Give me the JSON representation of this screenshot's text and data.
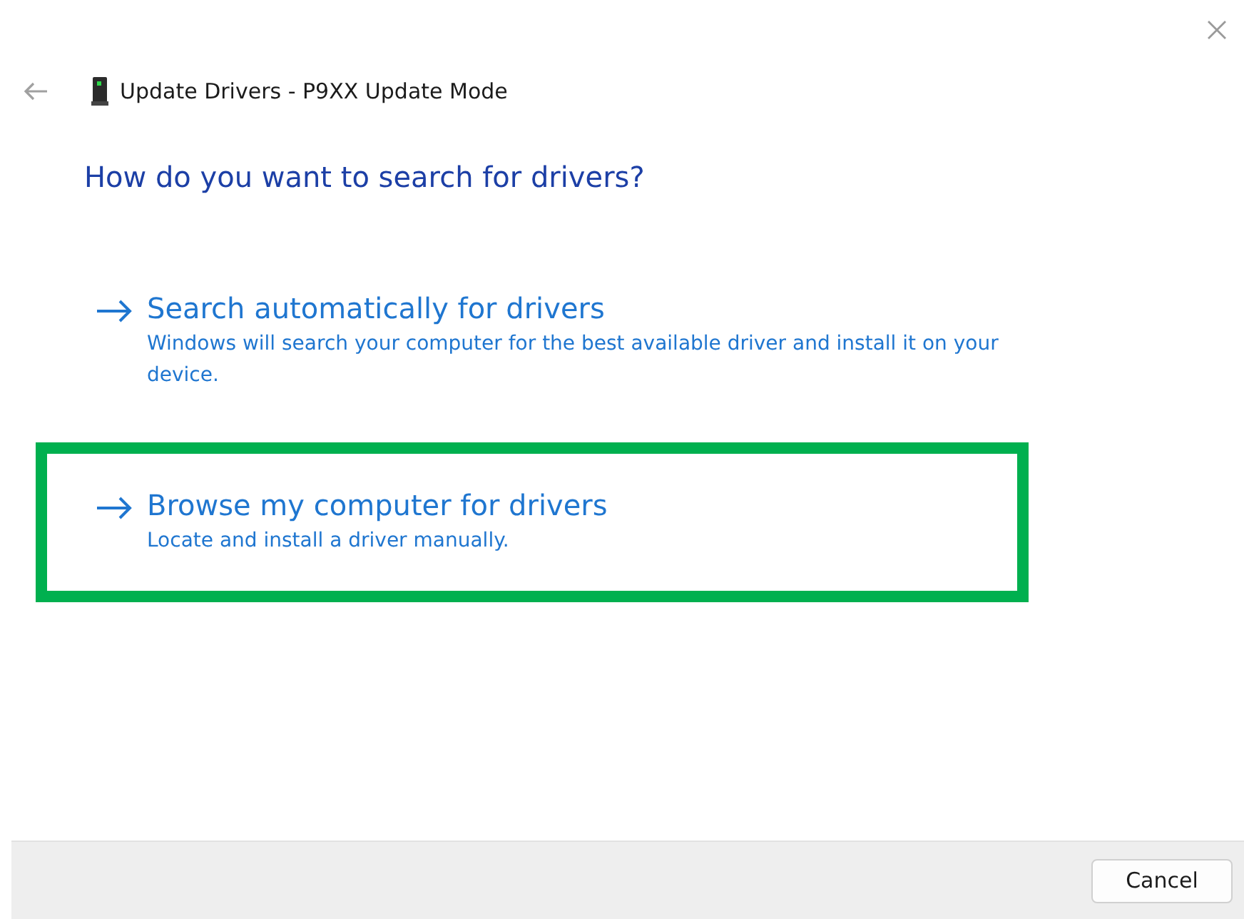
{
  "window": {
    "title": "Update Drivers - P9XX Update Mode"
  },
  "question": "How do you want to search for drivers?",
  "options": [
    {
      "title": "Search automatically for drivers",
      "description": "Windows will search your computer for the best available driver and install it on your device.",
      "highlighted": false
    },
    {
      "title": "Browse my computer for drivers",
      "description": "Locate and install a driver manually.",
      "highlighted": true
    }
  ],
  "buttons": [
    "Cancel"
  ]
}
